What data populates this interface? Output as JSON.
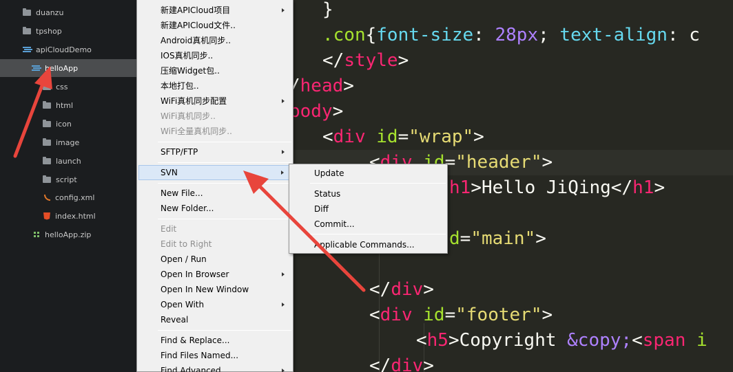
{
  "sidebar": {
    "items": [
      {
        "label": "duanzu",
        "icon": "folder-icon"
      },
      {
        "label": "tpshop",
        "icon": "folder-icon"
      },
      {
        "label": "apiCloudDemo",
        "icon": "project-icon"
      },
      {
        "label": "helloApp",
        "icon": "project-icon"
      },
      {
        "label": "css",
        "icon": "folder-icon"
      },
      {
        "label": "html",
        "icon": "folder-icon"
      },
      {
        "label": "icon",
        "icon": "folder-icon"
      },
      {
        "label": "image",
        "icon": "folder-icon"
      },
      {
        "label": "launch",
        "icon": "folder-icon"
      },
      {
        "label": "script",
        "icon": "folder-icon"
      },
      {
        "label": "config.xml",
        "icon": "rss-file-icon"
      },
      {
        "label": "index.html",
        "icon": "html5-file-icon"
      },
      {
        "label": "helloApp.zip",
        "icon": "zip-file-icon"
      }
    ]
  },
  "context_menu": {
    "items": [
      {
        "label": "新建APICloud项目"
      },
      {
        "label": "新建APICloud文件.."
      },
      {
        "label": "Android真机同步.."
      },
      {
        "label": "IOS真机同步.."
      },
      {
        "label": "压缩Widget包.."
      },
      {
        "label": "本地打包.."
      },
      {
        "label": "WiFi真机同步配置"
      },
      {
        "label": "WiFi真机同步.."
      },
      {
        "label": "WiFi全量真机同步.."
      },
      {
        "label": "SFTP/FTP"
      },
      {
        "label": "SVN"
      },
      {
        "label": "New File..."
      },
      {
        "label": "New Folder..."
      },
      {
        "label": "Edit"
      },
      {
        "label": "Edit to Right"
      },
      {
        "label": "Open / Run"
      },
      {
        "label": "Open In Browser"
      },
      {
        "label": "Open In New Window"
      },
      {
        "label": "Open With"
      },
      {
        "label": "Reveal"
      },
      {
        "label": "Find & Replace..."
      },
      {
        "label": "Find Files Named..."
      },
      {
        "label": "Find Advanced..."
      }
    ]
  },
  "svn_submenu": {
    "items": [
      {
        "label": "Update"
      },
      {
        "label": "Status"
      },
      {
        "label": "Diff"
      },
      {
        "label": "Commit..."
      },
      {
        "label": "Applicable Commands..."
      }
    ]
  },
  "editor": {
    "lines": [
      {
        "tokens": [
          {
            "t": "}",
            "c": "t-txt"
          }
        ]
      },
      {
        "tokens": [
          {
            "t": ".con",
            "c": "t-sel"
          },
          {
            "t": "{",
            "c": "t-txt"
          },
          {
            "t": "font-size",
            "c": "t-prop"
          },
          {
            "t": ": ",
            "c": "t-txt"
          },
          {
            "t": "28px",
            "c": "t-num"
          },
          {
            "t": "; ",
            "c": "t-txt"
          },
          {
            "t": "text-align",
            "c": "t-prop"
          },
          {
            "t": ": c",
            "c": "t-txt"
          }
        ]
      },
      {
        "tokens": [
          {
            "t": "</",
            "c": "t-txt"
          },
          {
            "t": "style",
            "c": "t-tag"
          },
          {
            "t": ">",
            "c": "t-txt"
          }
        ]
      },
      {
        "tokens": [
          {
            "t": "/",
            "c": "t-txt"
          },
          {
            "t": "head",
            "c": "t-tag"
          },
          {
            "t": ">",
            "c": "t-txt"
          }
        ]
      },
      {
        "tokens": [
          {
            "t": "body",
            "c": "t-tag"
          },
          {
            "t": ">",
            "c": "t-txt"
          }
        ]
      },
      {
        "tokens": [
          {
            "t": "<",
            "c": "t-txt"
          },
          {
            "t": "div",
            "c": "t-tag"
          },
          {
            "t": " ",
            "c": "t-txt"
          },
          {
            "t": "id",
            "c": "t-attr"
          },
          {
            "t": "=",
            "c": "t-txt"
          },
          {
            "t": "\"wrap\"",
            "c": "t-str"
          },
          {
            "t": ">",
            "c": "t-txt"
          }
        ]
      },
      {
        "tokens": [
          {
            "t": "<",
            "c": "t-txt"
          },
          {
            "t": "div",
            "c": "t-tag"
          },
          {
            "t": " ",
            "c": "t-txt"
          },
          {
            "t": "id",
            "c": "t-attr"
          },
          {
            "t": "=",
            "c": "t-txt"
          },
          {
            "t": "\"header\"",
            "c": "t-str"
          },
          {
            "t": ">",
            "c": "t-txt"
          }
        ]
      },
      {
        "tokens": [
          {
            "t": "h1",
            "c": "t-tag"
          },
          {
            "t": ">Hello JiQing</",
            "c": "t-txt"
          },
          {
            "t": "h1",
            "c": "t-tag"
          },
          {
            "t": ">",
            "c": "t-txt"
          }
        ]
      },
      {
        "tokens": []
      },
      {
        "tokens": [
          {
            "t": "d",
            "c": "t-attr"
          },
          {
            "t": "=",
            "c": "t-txt"
          },
          {
            "t": "\"main\"",
            "c": "t-str"
          },
          {
            "t": ">",
            "c": "t-txt"
          }
        ]
      },
      {
        "tokens": []
      },
      {
        "tokens": [
          {
            "t": "</",
            "c": "t-txt"
          },
          {
            "t": "div",
            "c": "t-tag"
          },
          {
            "t": ">",
            "c": "t-txt"
          }
        ]
      },
      {
        "tokens": [
          {
            "t": "<",
            "c": "t-txt"
          },
          {
            "t": "div",
            "c": "t-tag"
          },
          {
            "t": " ",
            "c": "t-txt"
          },
          {
            "t": "id",
            "c": "t-attr"
          },
          {
            "t": "=",
            "c": "t-txt"
          },
          {
            "t": "\"footer\"",
            "c": "t-str"
          },
          {
            "t": ">",
            "c": "t-txt"
          }
        ]
      },
      {
        "tokens": [
          {
            "t": "<",
            "c": "t-txt"
          },
          {
            "t": "h5",
            "c": "t-tag"
          },
          {
            "t": ">Copyright ",
            "c": "t-txt"
          },
          {
            "t": "&copy;",
            "c": "t-num"
          },
          {
            "t": "<",
            "c": "t-txt"
          },
          {
            "t": "span",
            "c": "t-tag"
          },
          {
            "t": " i",
            "c": "t-attr"
          }
        ]
      },
      {
        "tokens": [
          {
            "t": "</",
            "c": "t-txt"
          },
          {
            "t": "div",
            "c": "t-tag"
          },
          {
            "t": ">",
            "c": "t-txt"
          }
        ]
      }
    ]
  },
  "colors": {
    "annotation_arrow": "#e8453c",
    "menu_highlight": "#dbe8f7",
    "sidebar_selected": "#4b4d4f"
  }
}
